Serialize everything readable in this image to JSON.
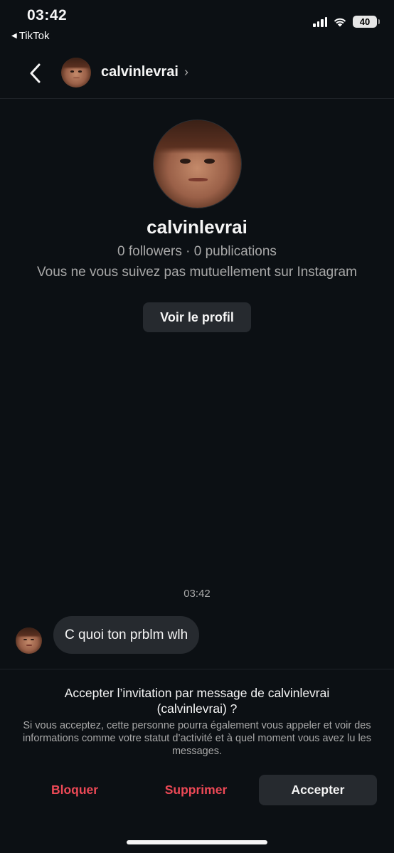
{
  "status_bar": {
    "time": "03:42",
    "back_app": "TikTok",
    "battery": "40",
    "icons": [
      "cellular-signal-icon",
      "wifi-icon",
      "battery-icon"
    ]
  },
  "header": {
    "username": "calvinlevrai",
    "chevron": "›",
    "icons": [
      "back-arrow-icon",
      "chevron-right-icon"
    ]
  },
  "profile": {
    "username": "calvinlevrai",
    "stats": "0 followers · 0 publications",
    "mutual": "Vous ne vous suivez pas mutuellement sur Instagram",
    "view_profile_label": "Voir le profil"
  },
  "messages": {
    "timestamp": "03:42",
    "items": [
      {
        "text": "C quoi ton prblm wlh"
      }
    ]
  },
  "request": {
    "title": "Accepter l’invitation par message de calvinlevrai (calvinlevrai) ?",
    "description": "Si vous acceptez, cette personne pourra également vous appeler et voir des informations comme votre statut d’activité et à quel moment vous avez lu les messages.",
    "block_label": "Bloquer",
    "delete_label": "Supprimer",
    "accept_label": "Accepter"
  },
  "colors": {
    "background": "#0c1014",
    "surface": "#262a2f",
    "danger": "#ed4956",
    "muted_text": "#a8a8a8"
  }
}
